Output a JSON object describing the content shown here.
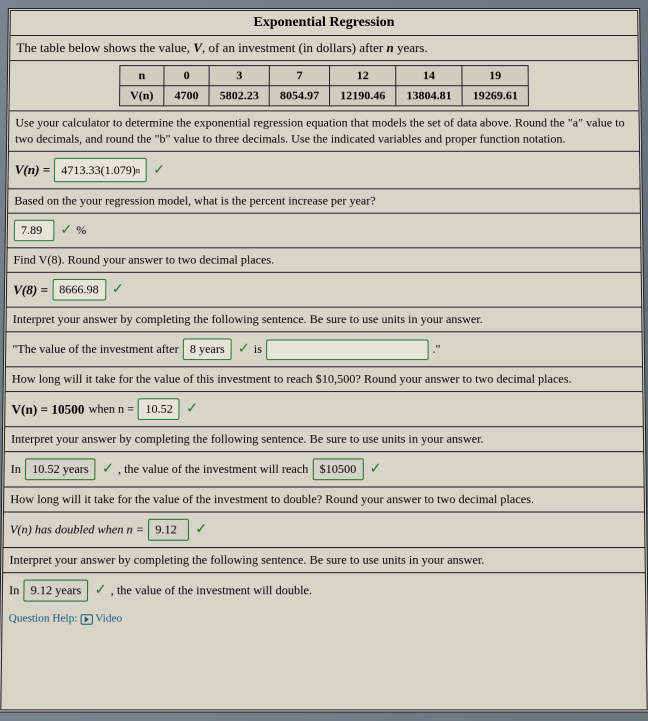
{
  "title": "Exponential Regression",
  "subtitle_prefix": "The table below shows the value, ",
  "subtitle_var": "V",
  "subtitle_mid": ", of an investment (in dollars) after ",
  "subtitle_nvar": "n",
  "subtitle_suffix": " years.",
  "table": {
    "row1_label": "n",
    "row2_label": "V(n)",
    "cols": [
      "0",
      "3",
      "7",
      "12",
      "14",
      "19"
    ],
    "vals": [
      "4700",
      "5802.23",
      "8054.97",
      "12190.46",
      "13804.81",
      "19269.61"
    ]
  },
  "instr1": "Use your calculator to determine the exponential regression equation that models the set of data above. Round the \"a\" value to two decimals, and round the \"b\" value to three decimals. Use the indicated variables and proper function notation.",
  "q1": {
    "label": "V(n) =",
    "value": "4713.33(1.079)",
    "exp": "n"
  },
  "q2": {
    "prompt": "Based on the your regression model, what is the percent increase per year?",
    "value": "7.89",
    "unit": "%"
  },
  "q3": {
    "prompt": "Find V(8). Round your answer to two decimal places.",
    "label": "V(8) =",
    "value": "8666.98"
  },
  "q4": {
    "prompt": "Interpret your answer by completing the following sentence. Be sure to use units in your answer.",
    "lead": "\"The value of the investment after",
    "box1": "8 years",
    "mid": "is",
    "box2": "",
    "trail": ".\""
  },
  "q5": {
    "prompt": "How long will it take for the value of this investment to reach $10,500? Round your answer to two decimal places.",
    "label_a": "V(n) = 10500",
    "label_b": "when n =",
    "value": "10.52"
  },
  "q6": {
    "prompt": "Interpret your answer by completing the following sentence. Be sure to use units in your answer.",
    "lead": "In",
    "box1": "10.52 years",
    "mid": ", the value of the investment will reach",
    "box2": "$10500"
  },
  "q7": {
    "prompt": "How long will it take for the value of the investment to double? Round your answer to two decimal places.",
    "label": "V(n) has doubled when n =",
    "value": "9.12"
  },
  "q8": {
    "prompt": "Interpret your answer by completing the following sentence. Be sure to use units in your answer.",
    "lead": "In",
    "box1": "9.12 years",
    "mid": ", the value of the investment will double."
  },
  "help_label": "Question Help:",
  "help_video": "Video"
}
